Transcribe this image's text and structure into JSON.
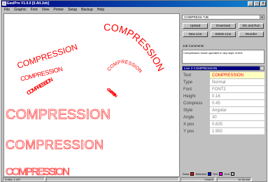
{
  "window": {
    "title": "EasiPro  V1.0.0  [0.All.Job]",
    "buttons": [
      "_",
      "□",
      "×"
    ]
  },
  "menu": [
    "File",
    "Graphic",
    "Font",
    "View",
    "Printer",
    "Setup",
    "Backup",
    "Help"
  ],
  "canvas": {
    "text": "COMPRESSION",
    "colors": {
      "normal": "#ff0000",
      "selected": "#0000ff",
      "background": "#ffffff"
    }
  },
  "panel": {
    "job": "COMPRESS TJB",
    "buttons": {
      "upload": "Upload",
      "download": "Download",
      "dl_and_run": "D/L and Run",
      "new_line": "New Line",
      "delete_line": "Delete Line",
      "reorder": "Reorder"
    },
    "comments_label": "Job Comments",
    "comments": "Compression mode operates in any style of text",
    "line_select": "Line 3 COMPRESSION",
    "properties": [
      {
        "name": "Text",
        "value": "COMPRESSION"
      },
      {
        "name": "Type",
        "value": "Normal"
      },
      {
        "name": "Font",
        "value": "FONT2"
      },
      {
        "name": "Height",
        "value": "0.16"
      },
      {
        "name": "Compress",
        "value": "0.45"
      },
      {
        "name": "Style",
        "value": "Angular"
      },
      {
        "name": "Angle",
        "value": "30"
      },
      {
        "name": "X pos",
        "value": "0.825"
      },
      {
        "name": "Y pos",
        "value": "1.992"
      }
    ],
    "legend": {
      "draw": "Draw",
      "selected": "Selected",
      "text": "Text",
      "grid": "Grid"
    }
  },
  "status": {
    "coords": "3.965, 1.197",
    "date": "7/28/03",
    "time": "10:35 AM"
  }
}
